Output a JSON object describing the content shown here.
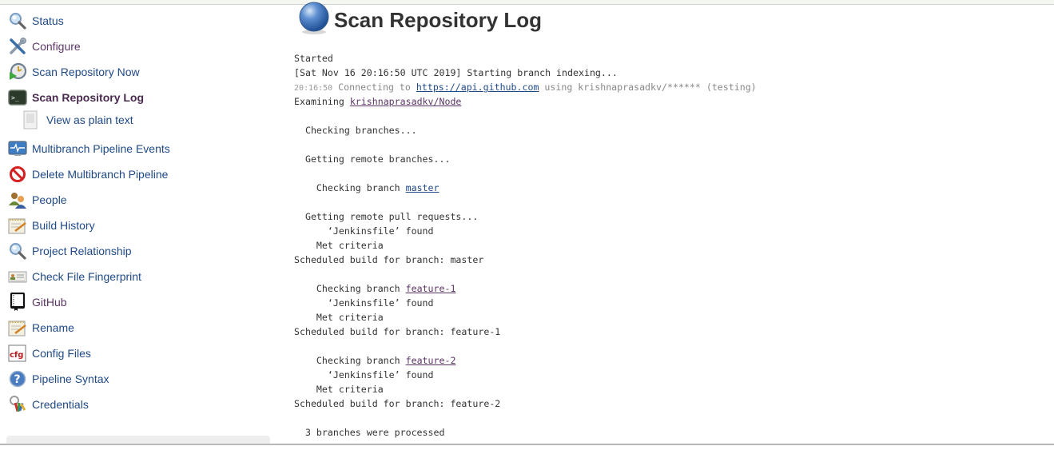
{
  "page": {
    "title": "Scan Repository Log"
  },
  "sidebar": {
    "items": [
      {
        "label": "Status",
        "icon": "magnifier-icon"
      },
      {
        "label": "Configure",
        "icon": "wrench-screwdriver-icon"
      },
      {
        "label": "Scan Repository Now",
        "icon": "clock-play-icon"
      },
      {
        "label": "Scan Repository Log",
        "icon": "terminal-icon",
        "active": true
      },
      {
        "label": "View as plain text",
        "icon": "document-icon",
        "sub": true
      },
      {
        "label": "Multibranch Pipeline Events",
        "icon": "monitor-pulse-icon"
      },
      {
        "label": "Delete Multibranch Pipeline",
        "icon": "no-entry-icon"
      },
      {
        "label": "People",
        "icon": "people-icon"
      },
      {
        "label": "Build History",
        "icon": "notepad-icon"
      },
      {
        "label": "Project Relationship",
        "icon": "magnifier-icon"
      },
      {
        "label": "Check File Fingerprint",
        "icon": "id-card-icon"
      },
      {
        "label": "GitHub",
        "icon": "github-book-icon"
      },
      {
        "label": "Rename",
        "icon": "notepad-icon"
      },
      {
        "label": "Config Files",
        "icon": "cfg-icon"
      },
      {
        "label": "Pipeline Syntax",
        "icon": "help-icon"
      },
      {
        "label": "Credentials",
        "icon": "keys-icon"
      }
    ]
  },
  "log": {
    "started": "Started",
    "indexing": "[Sat Nov 16 20:16:50 UTC 2019] Starting branch indexing...",
    "connect_ts": "20:16:50",
    "connect_prefix": " Connecting to ",
    "connect_url": "https://api.github.com",
    "connect_suffix": " using krishnaprasadkv/****** (testing)",
    "examining_prefix": "Examining ",
    "examining_repo": "krishnaprasadkv/Node",
    "checking_branches": "  Checking branches...",
    "getting_remote_branches": "  Getting remote branches...",
    "checking_branch_prefix": "    Checking branch ",
    "getting_pull_requests": "  Getting remote pull requests...",
    "jenkinsfile_found": "      ‘Jenkinsfile’ found",
    "met_criteria": "    Met criteria",
    "scheduled_prefix": "Scheduled build for branch: ",
    "branches": [
      "master",
      "feature-1",
      "feature-2"
    ],
    "summary": "  3 branches were processed"
  }
}
